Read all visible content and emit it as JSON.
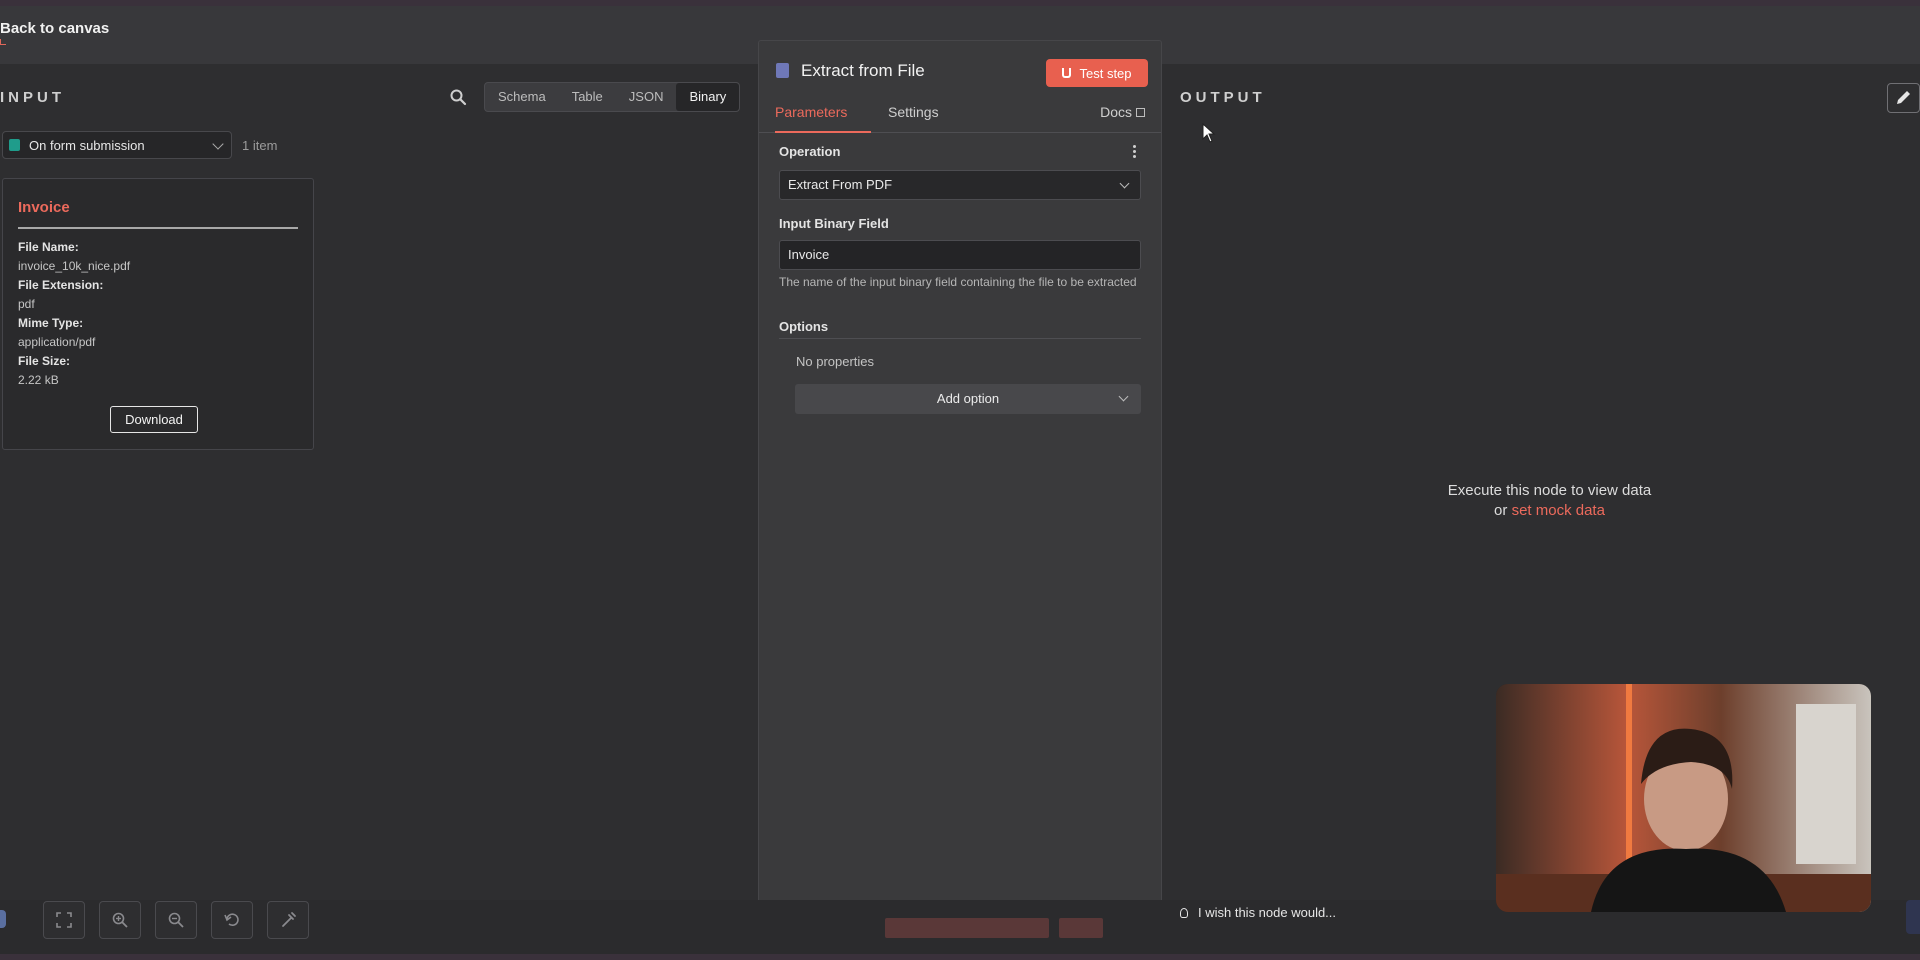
{
  "nav": {
    "back_label": "Back to canvas"
  },
  "input": {
    "title": "INPUT",
    "view_tabs": [
      "Schema",
      "Table",
      "JSON",
      "Binary"
    ],
    "active_view": "Binary",
    "source_select": "On form submission",
    "item_count": "1 item",
    "binary_card": {
      "title": "Invoice",
      "fields": [
        {
          "key": "File Name:",
          "value": "invoice_10k_nice.pdf"
        },
        {
          "key": "File Extension:",
          "value": "pdf"
        },
        {
          "key": "Mime Type:",
          "value": "application/pdf"
        },
        {
          "key": "File Size:",
          "value": "2.22 kB"
        }
      ],
      "download_label": "Download"
    }
  },
  "node": {
    "title": "Extract from File",
    "test_button": "Test step",
    "tabs": {
      "parameters": "Parameters",
      "settings": "Settings",
      "docs": "Docs"
    },
    "operation_label": "Operation",
    "operation_value": "Extract From PDF",
    "binary_field_label": "Input Binary Field",
    "binary_field_value": "Invoice",
    "binary_field_hint": "The name of the input binary field containing the file to be extracted",
    "options_label": "Options",
    "no_properties": "No properties",
    "add_option": "Add option"
  },
  "output": {
    "title": "OUTPUT",
    "empty_line1": "Execute this node to view data",
    "empty_or": "or",
    "mock_link": "set mock data"
  },
  "footer": {
    "wish_text": "I wish this node would..."
  },
  "colors": {
    "accent": "#ec6a5c",
    "test_button": "#e8604f",
    "panel": "#3a3a3c",
    "background": "#2e2e30"
  }
}
